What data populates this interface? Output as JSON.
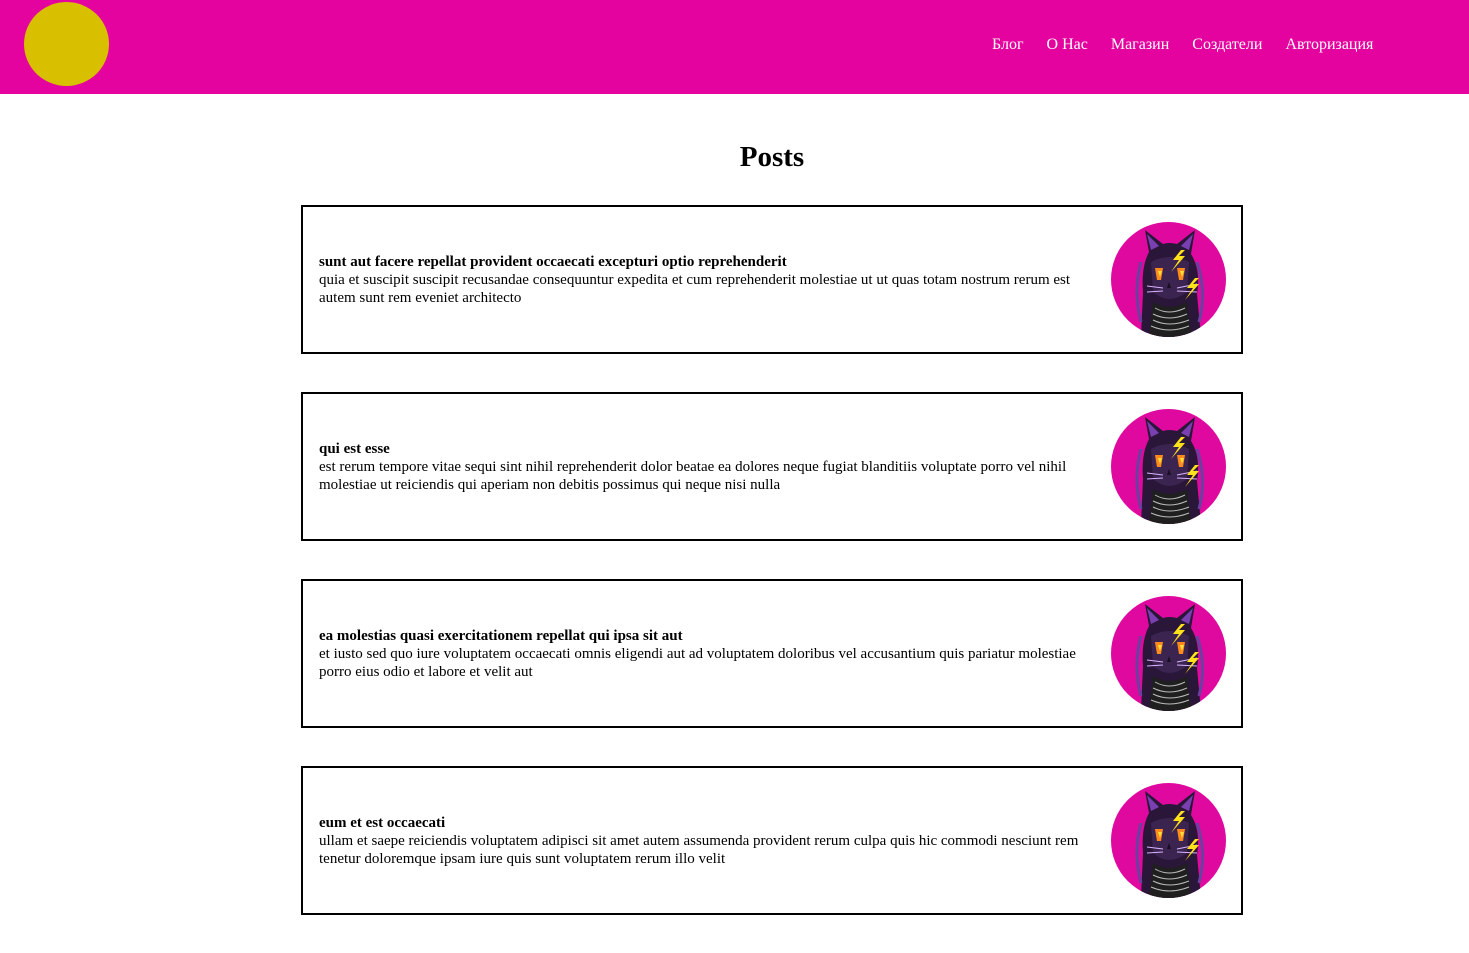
{
  "header": {
    "bg_color": "#e4039e",
    "logo_color": "#d8bf00",
    "nav": [
      {
        "label": "Блог"
      },
      {
        "label": "О Нас"
      },
      {
        "label": "Магазин"
      },
      {
        "label": "Создатели"
      },
      {
        "label": "Авторизация"
      }
    ]
  },
  "main": {
    "title": "Posts",
    "posts": [
      {
        "title": "sunt aut facere repellat provident occaecati excepturi optio reprehenderit",
        "body": "quia et suscipit suscipit recusandae consequuntur expedita et cum reprehenderit molestiae ut ut quas totam nostrum rerum est autem sunt rem eveniet architecto"
      },
      {
        "title": "qui est esse",
        "body": "est rerum tempore vitae sequi sint nihil reprehenderit dolor beatae ea dolores neque fugiat blanditiis voluptate porro vel nihil molestiae ut reiciendis qui aperiam non debitis possimus qui neque nisi nulla"
      },
      {
        "title": "ea molestias quasi exercitationem repellat qui ipsa sit aut",
        "body": "et iusto sed quo iure voluptatem occaecati omnis eligendi aut ad voluptatem doloribus vel accusantium quis pariatur molestiae porro eius odio et labore et velit aut"
      },
      {
        "title": "eum et est occaecati",
        "body": "ullam et saepe reiciendis voluptatem adipisci sit amet autem assumenda provident rerum culpa quis hic commodi nesciunt rem tenetur doloremque ipsam iure quis sunt voluptatem rerum illo velit"
      }
    ]
  }
}
